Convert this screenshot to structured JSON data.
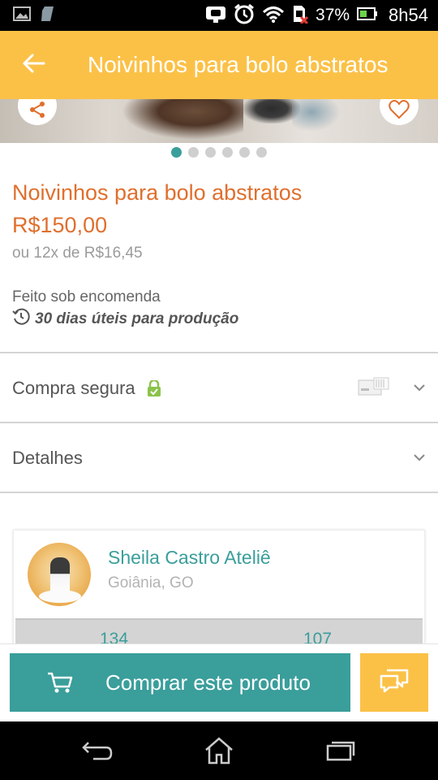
{
  "status_bar": {
    "battery_percent": "37%",
    "time": "8h54"
  },
  "app_bar": {
    "title": "Noivinhos para bolo abstratos"
  },
  "gallery": {
    "image_count": 6,
    "active_index": 0
  },
  "product": {
    "title": "Noivinhos para bolo abstratos",
    "price": "R$150,00",
    "installments": "ou 12x de R$16,45",
    "made_to_order": "Feito sob encomenda",
    "production_time": "30 dias úteis para produção"
  },
  "sections": {
    "secure_purchase_label": "Compra segura",
    "details_label": "Detalhes"
  },
  "seller": {
    "name": "Sheila Castro Ateliê",
    "location": "Goiânia, GO",
    "stat_1": "134",
    "stat_2": "107"
  },
  "actions": {
    "buy_label": "Comprar este produto"
  },
  "colors": {
    "brand_yellow": "#fbc147",
    "accent_teal": "#3a9e9b",
    "price_orange": "#e06f2d"
  },
  "icons": {
    "status_left": [
      "image-icon",
      "sim-card-icon"
    ],
    "status_right": [
      "silent-mode-icon",
      "alarm-icon",
      "wifi-icon",
      "sim-no-signal-icon",
      "battery-icon"
    ],
    "toolbar": [
      "back-arrow-icon",
      "share-icon",
      "heart-icon"
    ],
    "purchase": [
      "cart-icon",
      "chat-icon"
    ],
    "navigation": [
      "nav-back-icon",
      "nav-home-icon",
      "nav-recent-apps-icon"
    ]
  }
}
